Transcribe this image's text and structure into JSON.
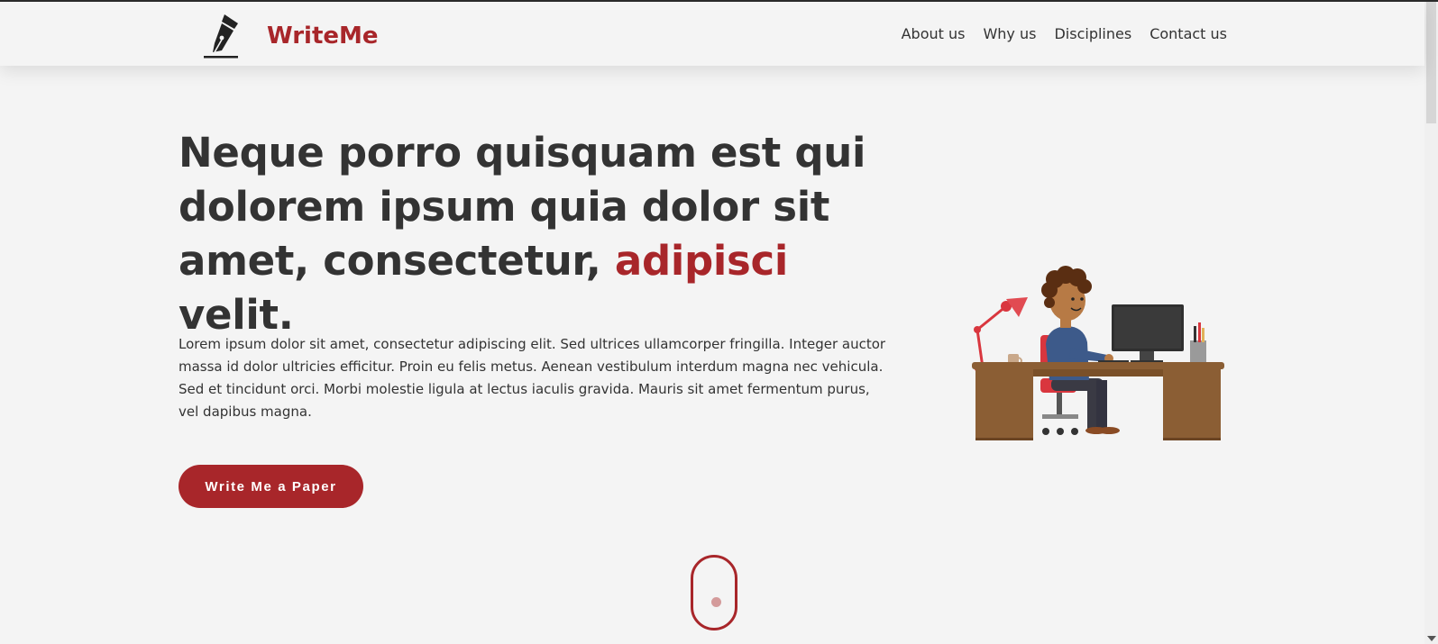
{
  "brand": {
    "name": "WriteMe",
    "logo_icon": "fountain-pen-nib-icon",
    "color": "#a8262a"
  },
  "nav": {
    "items": [
      "About us",
      "Why us",
      "Disciplines",
      "Contact us"
    ]
  },
  "hero": {
    "title_part1": "Neque porro quisquam est qui dolorem ipsum quia dolor sit amet, consectetur, ",
    "title_accent": "adipisci",
    "title_part2": " velit.",
    "text": "Lorem ipsum dolor sit amet, consectetur adipiscing elit. Sed ultrices ullamcorper fringilla. Integer auctor massa id dolor ultricies efficitur. Proin eu felis metus. Aenean vestibulum interdum magna nec vehicula. Sed et tincidunt orci. Morbi molestie ligula at lectus iaculis gravida. Mauris sit amet fermentum purus, vel dapibus magna.",
    "cta_label": "Write Me a Paper",
    "illustration": "person-at-desk-illustration"
  },
  "scroll_indicator": {
    "icon": "mouse-scroll-icon"
  },
  "colors": {
    "accent": "#a8262a",
    "background": "#f4f4f4",
    "text": "#333333"
  }
}
